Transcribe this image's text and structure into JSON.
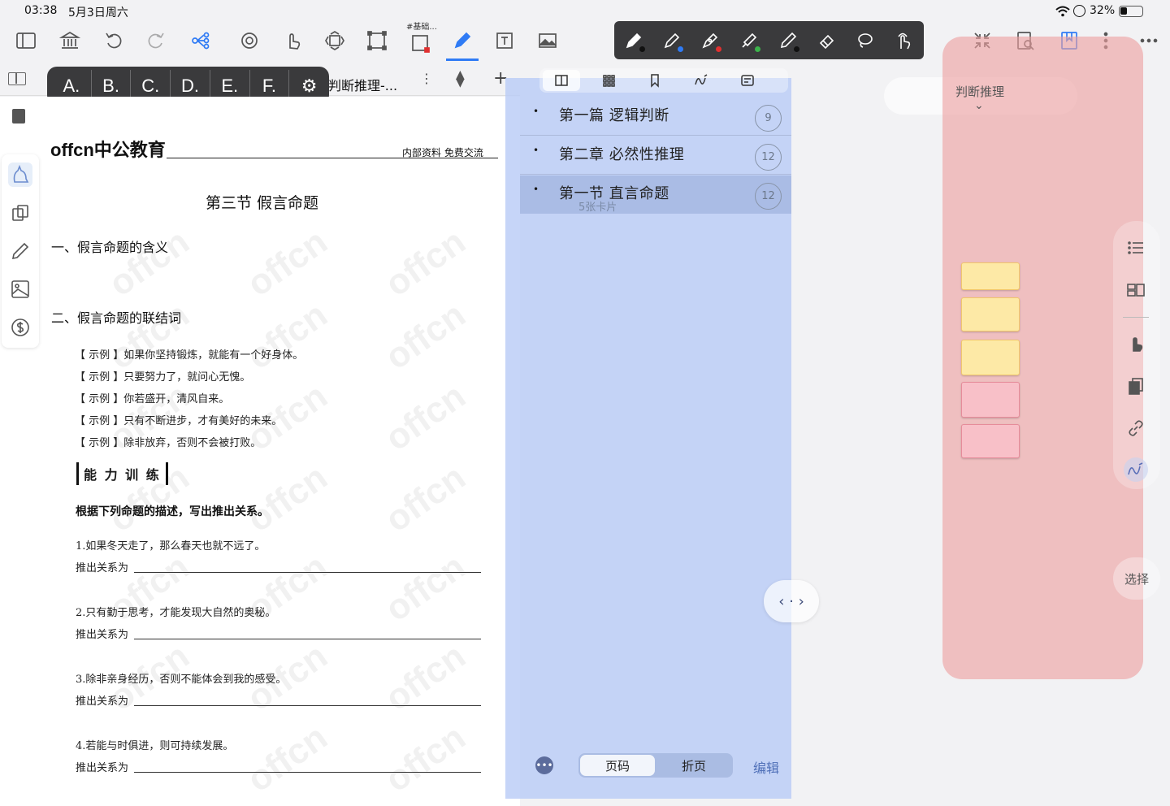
{
  "status_bar": {
    "time": "03:38",
    "date": "5月3日周六",
    "battery": "32%"
  },
  "toolbar": {
    "doc_hint": "#基础...",
    "icons": [
      "sidebar-icon",
      "library-icon",
      "undo-icon",
      "redo-icon",
      "mindmap-icon",
      "settings-sync-icon",
      "hand-icon",
      "resize-icon",
      "crop-icon",
      "selection-icon",
      "pen-icon",
      "textbox-icon",
      "image-icon"
    ],
    "right_icons": [
      "collapse-icon",
      "search-doc-icon",
      "bookmark-icon",
      "more-vertical-icon",
      "more-horizontal-icon"
    ]
  },
  "pen_toolbar": {
    "tools": [
      {
        "name": "fountain-pen-icon",
        "color": "#111111"
      },
      {
        "name": "pen-icon",
        "color": "#2f7bf5"
      },
      {
        "name": "calligraphy-pen-icon",
        "color": "#e03030"
      },
      {
        "name": "highlighter-icon",
        "color": "#3cb44b"
      },
      {
        "name": "pencil-icon",
        "color": "#111111"
      },
      {
        "name": "eraser-icon",
        "color": ""
      },
      {
        "name": "lasso-icon",
        "color": ""
      },
      {
        "name": "finger-touch-icon",
        "color": ""
      }
    ]
  },
  "letter_bar": {
    "letters": [
      "A.",
      "B.",
      "C.",
      "D.",
      "E.",
      "F."
    ]
  },
  "tab": {
    "title": "判断推理-..."
  },
  "document": {
    "brand": "offcn中公教育",
    "header_note": "内部资料  免费交流",
    "section_title": "第三节    假言命题",
    "heading1": "一、假言命题的含义",
    "heading2": "二、假言命题的联结词",
    "examples": [
      "【 示例 】如果你坚持锻炼，就能有一个好身体。",
      "【 示例 】只要努力了，就问心无愧。",
      "【 示例 】你若盛开，清风自来。",
      "【 示例 】只有不断进步，才有美好的未来。",
      "【 示例 】除非放弃，否则不会被打败。"
    ],
    "training_label": "能 力 训 练",
    "instruction": "根据下列命题的描述，写出推出关系。",
    "questions": [
      {
        "q": "1.如果冬天走了，那么春天也就不远了。",
        "a": "推出关系为"
      },
      {
        "q": "2.只有勤于思考，才能发现大自然的奥秘。",
        "a": "推出关系为"
      },
      {
        "q": "3.除非亲身经历，否则不能体会到我的感受。",
        "a": "推出关系为"
      },
      {
        "q": "4.若能与时俱进，则可持续发展。",
        "a": "推出关系为"
      }
    ],
    "watermark": "offcn"
  },
  "outline": {
    "items": [
      {
        "title": "第一篇  逻辑判断",
        "sub": "",
        "count": "9"
      },
      {
        "title": "第二章  必然性推理",
        "sub": "",
        "count": "12"
      },
      {
        "title": "第一节  直言命题",
        "sub": "5张卡片",
        "count": "12"
      }
    ],
    "segments": [
      "页码",
      "折页"
    ],
    "edit_label": "编辑"
  },
  "card_pane": {
    "title": "判断推理",
    "select_label": "选择",
    "card_colors": [
      "#fde9a6",
      "#fde9a6",
      "#fde9a6",
      "#f6a8b4",
      "#f6a8b4"
    ]
  },
  "colors": {
    "accent": "#2f7bf5",
    "outline_overlay": "#bacdf6",
    "card_overlay": "#eda0a0"
  }
}
